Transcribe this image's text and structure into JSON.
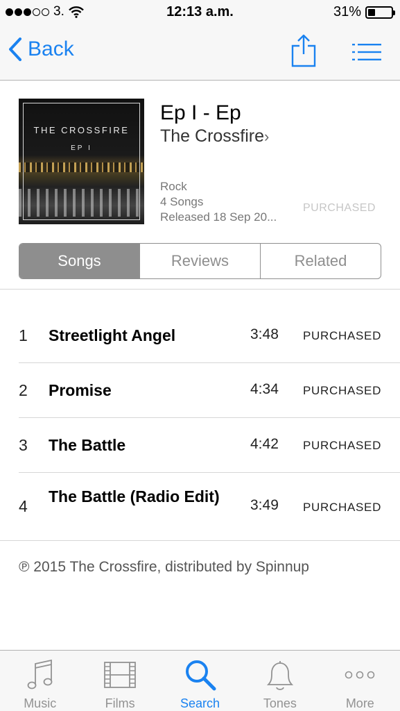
{
  "status_bar": {
    "carrier": "3.",
    "time": "12:13 a.m.",
    "battery": "31%",
    "battery_level": 0.31
  },
  "navbar": {
    "back_label": "Back"
  },
  "album": {
    "art_title": "THE CROSSFIRE",
    "art_subtitle": "EP I",
    "title": "Ep I - Ep",
    "artist": "The Crossfire",
    "genre": "Rock",
    "song_count": "4 Songs",
    "released": "Released 18 Sep 20...",
    "purchase_status": "PURCHASED"
  },
  "segments": [
    "Songs",
    "Reviews",
    "Related"
  ],
  "segments_active": "Songs",
  "songs": [
    {
      "num": "1",
      "title": "Streetlight Angel",
      "duration": "3:48",
      "status": "PURCHASED"
    },
    {
      "num": "2",
      "title": "Promise",
      "duration": "4:34",
      "status": "PURCHASED"
    },
    {
      "num": "3",
      "title": "The Battle",
      "duration": "4:42",
      "status": "PURCHASED"
    },
    {
      "num": "4",
      "title": "The Battle (Radio Edit)",
      "duration": "3:49",
      "status": "PURCHASED"
    }
  ],
  "copyright": "℗ 2015 The Crossfire, distributed by Spinnup",
  "tabbar": [
    {
      "label": "Music",
      "icon": "music-note-icon"
    },
    {
      "label": "Films",
      "icon": "film-icon"
    },
    {
      "label": "Search",
      "icon": "search-icon"
    },
    {
      "label": "Tones",
      "icon": "bell-icon"
    },
    {
      "label": "More",
      "icon": "more-icon"
    }
  ],
  "tabbar_active": "Search",
  "colors": {
    "accent": "#1a82f0",
    "segment_active": "#8e8e8e",
    "tab_inactive": "#929292"
  }
}
